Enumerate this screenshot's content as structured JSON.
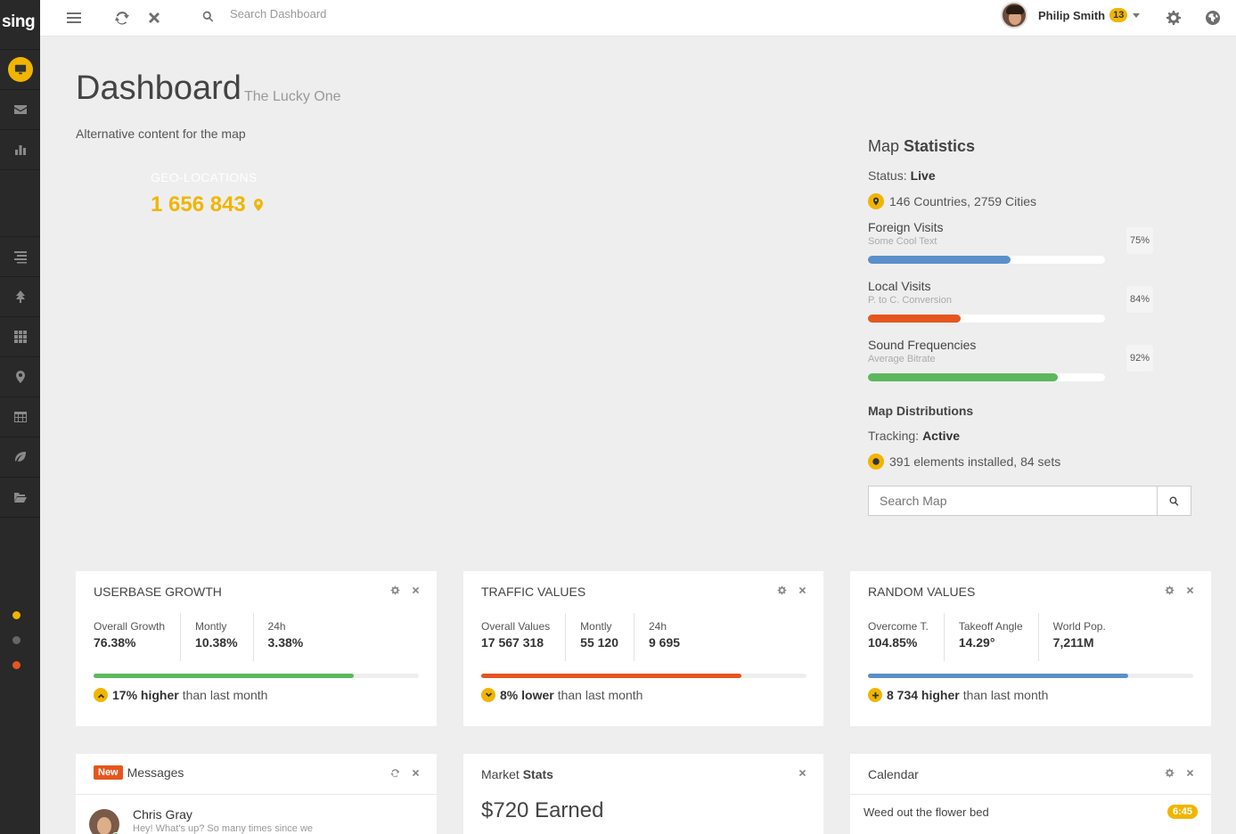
{
  "brand": "sing",
  "topbar": {
    "search_placeholder": "Search Dashboard",
    "user_name": "Philip Smith",
    "notifications": "13"
  },
  "page": {
    "title": "Dashboard",
    "subtitle": "The Lucky One",
    "alt_content": "Alternative content for the map",
    "geo_label": "GEO-LOCATIONS",
    "geo_value": "1 656 843"
  },
  "map_stats": {
    "title_light": "Map",
    "title_bold": "Statistics",
    "status_label": "Status:",
    "status_value": "Live",
    "countries": "146 Countries, 2759 Cities",
    "progress": [
      {
        "title": "Foreign Visits",
        "sub": "Some Cool Text",
        "pct_label": "75%",
        "value": 0.6,
        "color": "#5b8fc9"
      },
      {
        "title": "Local Visits",
        "sub": "P. to C. Conversion",
        "pct_label": "84%",
        "value": 0.39,
        "color": "#e5561e"
      },
      {
        "title": "Sound Frequencies",
        "sub": "Average Bitrate",
        "pct_label": "92%",
        "value": 0.8,
        "color": "#5cb85c"
      }
    ],
    "dist_title": "Map Distributions",
    "tracking_label": "Tracking:",
    "tracking_value": "Active",
    "elements": "391 elements installed, 84 sets",
    "search_placeholder": "Search Map"
  },
  "widgets": [
    {
      "title": "USERBASE GROWTH",
      "cols": [
        {
          "label": "Overall Growth",
          "value": "76.38%"
        },
        {
          "label": "Montly",
          "value": "10.38%"
        },
        {
          "label": "24h",
          "value": "3.38%"
        }
      ],
      "bar_value": 0.8,
      "bar_color": "#5cb85c",
      "foot_bold": "17% higher",
      "foot_rest": "than last month"
    },
    {
      "title": "TRAFFIC VALUES",
      "cols": [
        {
          "label": "Overall Values",
          "value": "17 567 318"
        },
        {
          "label": "Montly",
          "value": "55 120"
        },
        {
          "label": "24h",
          "value": "9 695"
        }
      ],
      "bar_value": 0.8,
      "bar_color": "#e5561e",
      "foot_bold": "8% lower",
      "foot_rest": "than last month"
    },
    {
      "title": "RANDOM VALUES",
      "cols": [
        {
          "label": "Overcome T.",
          "value": "104.85%"
        },
        {
          "label": "Takeoff Angle",
          "value": "14.29°"
        },
        {
          "label": "World Pop.",
          "value": "7,211M"
        }
      ],
      "bar_value": 0.8,
      "bar_color": "#5b8fc9",
      "foot_bold": "8 734 higher",
      "foot_rest": "than last month"
    }
  ],
  "messages": {
    "badge": "New",
    "title": "Messages",
    "name": "Chris Gray",
    "text": "Hey! What's up? So many times since we"
  },
  "market": {
    "title_light": "Market",
    "title_bold": "Stats",
    "earned": "$720 Earned"
  },
  "calendar": {
    "title": "Calendar",
    "item": "Weed out the flower bed",
    "time": "6:45"
  }
}
